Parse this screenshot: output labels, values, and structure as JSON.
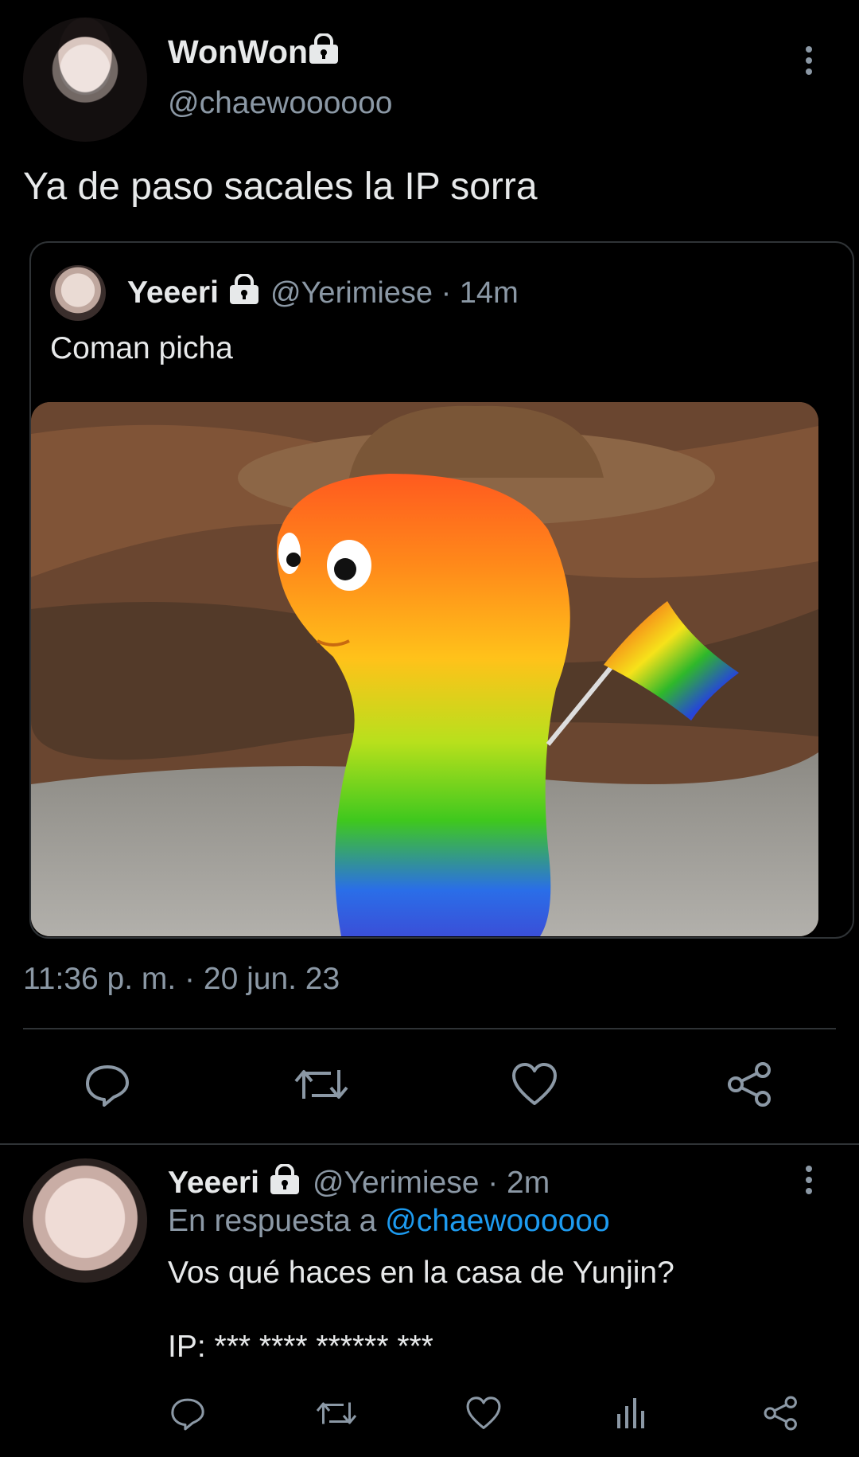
{
  "main_tweet": {
    "author_name": "WonWon",
    "author_handle": "@chaewoooooo",
    "text": "Ya de paso sacales la IP sorra",
    "timestamp": "11:36 p. m. · 20 jun. 23"
  },
  "quoted_tweet": {
    "author_name": "Yeeeri",
    "author_handle": "@Yerimiese · 14m",
    "text": "Coman picha"
  },
  "reply": {
    "author_name": "Yeeeri",
    "author_handle": "@Yerimiese · 2m",
    "reply_prefix": "En respuesta a ",
    "reply_mention": "@chaewoooooo",
    "text_line1": "Vos qué haces en la casa de Yunjin?",
    "text_line2": "IP: *** **** ****** ***"
  },
  "icons": {
    "lock": "lock-icon",
    "more": "more-vertical-icon",
    "reply": "reply-icon",
    "retweet": "retweet-icon",
    "like": "heart-icon",
    "share": "share-icon",
    "analytics": "analytics-icon"
  },
  "colors": {
    "background": "#000000",
    "text": "#e7e9ea",
    "secondary": "#8b98a5",
    "link": "#1d9bf0",
    "border": "#2f3336"
  }
}
